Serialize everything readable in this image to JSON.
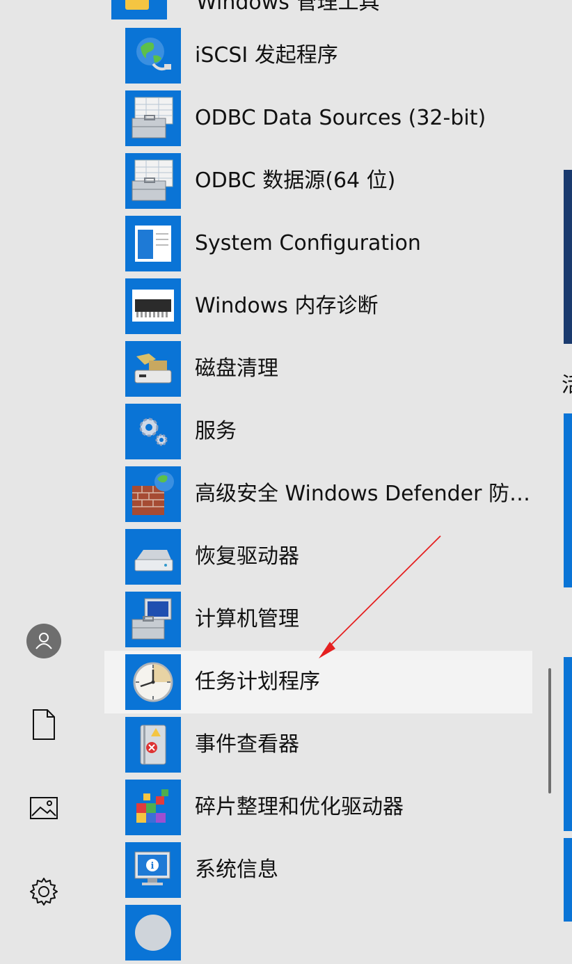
{
  "folder": {
    "label": "Windows 管理工具",
    "icon": "folder-icon"
  },
  "apps": [
    {
      "label": "iSCSI 发起程序",
      "icon": "globe-network-icon",
      "selected": false
    },
    {
      "label": "ODBC Data Sources (32-bit)",
      "icon": "toolbox-table-icon",
      "selected": false
    },
    {
      "label": "ODBC 数据源(64 位)",
      "icon": "toolbox-table-icon",
      "selected": false
    },
    {
      "label": "System Configuration",
      "icon": "window-config-icon",
      "selected": false
    },
    {
      "label": "Windows 内存诊断",
      "icon": "memory-chip-icon",
      "selected": false
    },
    {
      "label": "磁盘清理",
      "icon": "disk-cleanup-icon",
      "selected": false
    },
    {
      "label": "服务",
      "icon": "gears-icon",
      "selected": false
    },
    {
      "label": "高级安全 Windows Defender 防…",
      "icon": "firewall-icon",
      "selected": false
    },
    {
      "label": "恢复驱动器",
      "icon": "drive-icon",
      "selected": false
    },
    {
      "label": "计算机管理",
      "icon": "computer-management-icon",
      "selected": false
    },
    {
      "label": "任务计划程序",
      "icon": "clock-icon",
      "selected": true
    },
    {
      "label": "事件查看器",
      "icon": "event-log-icon",
      "selected": false
    },
    {
      "label": "碎片整理和优化驱动器",
      "icon": "defrag-icon",
      "selected": false
    },
    {
      "label": "系统信息",
      "icon": "monitor-info-icon",
      "selected": false
    }
  ],
  "rail": {
    "account": "user-account-icon",
    "documents": "document-icon",
    "pictures": "pictures-icon",
    "settings": "gear-icon"
  },
  "right_edge_glyph": "活",
  "colors": {
    "tile_blue": "#0a74d6",
    "background": "#e6e6e6",
    "selected_row": "#f3f3f3",
    "annotation_arrow": "#e52020",
    "right_tiles": "#0a74d6",
    "right_tile_dark": "#1a3a6e"
  }
}
